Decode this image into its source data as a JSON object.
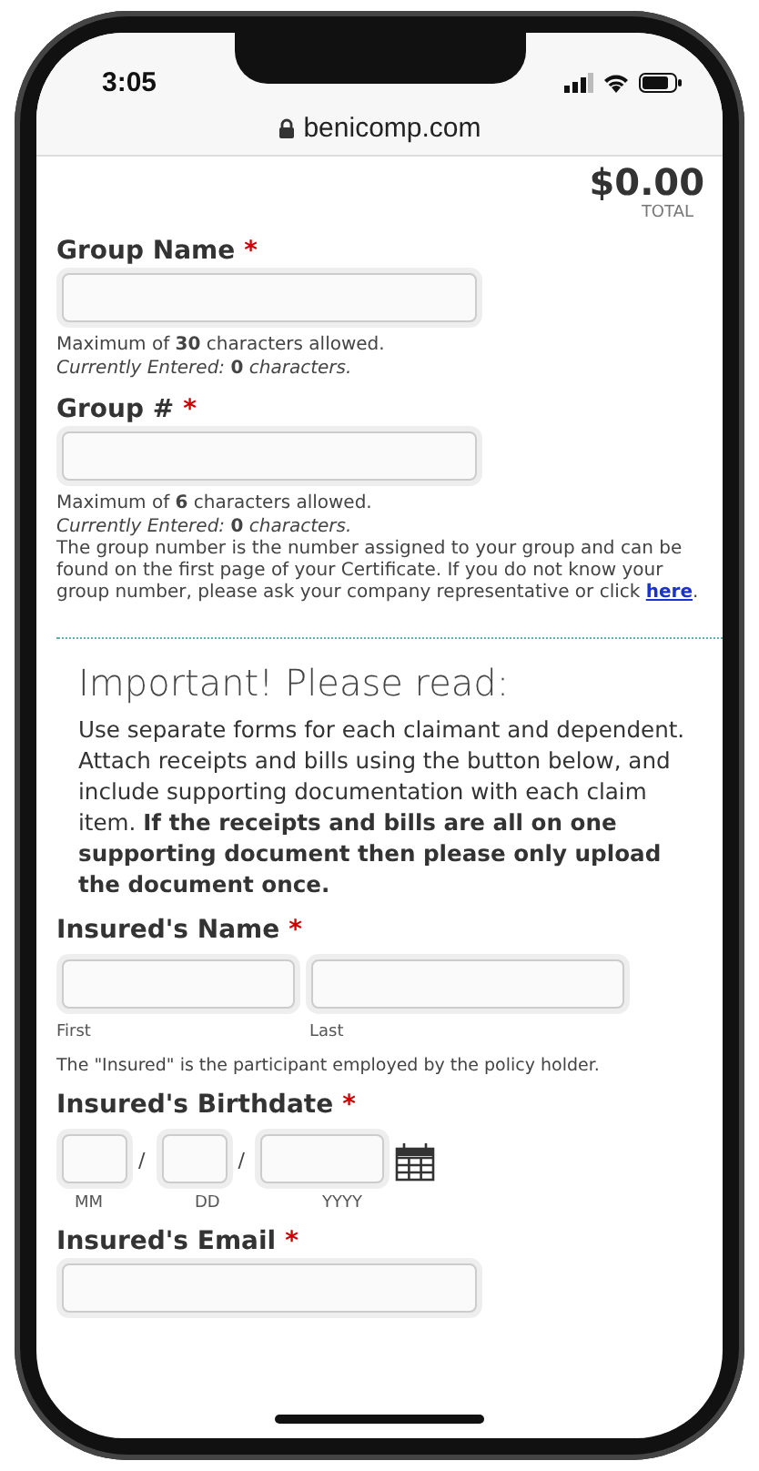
{
  "status_bar": {
    "time": "3:05"
  },
  "address_bar": {
    "url": "benicomp.com"
  },
  "total": {
    "amount": "$0.00",
    "label": "TOTAL"
  },
  "group_name": {
    "label": "Group Name",
    "required": "*",
    "hints": [
      "Maximum of **30** characters allowed.",
      "*Currently Entered:* **0** *characters.*"
    ]
  },
  "group_number": {
    "label": "Group #",
    "required": "*",
    "hints": [
      "Maximum of **6** characters allowed.",
      "*Currently Entered:* **0** *characters.*"
    ],
    "help": {
      "text": "The group number is the number assigned to your group and can be found on the first page of your Certificate. If you do not know your group number, please ask your company representative or click",
      "link": "here",
      "after": "."
    }
  },
  "notice": {
    "heading": "Important! Please read:",
    "body": "Use separate forms for each claimant and dependent. Attach receipts and bills using the button below, and include supporting documentation with each claim item. **If the receipts and bills are all on one supporting document then please only upload the document once.**"
  },
  "insured_name": {
    "label": "Insured's Name",
    "required": "*",
    "sublabels": [
      "First",
      "Last"
    ],
    "note": "The \"Insured\" is the participant employed by the policy holder."
  },
  "insured_birthdate": {
    "label": "Insured's Birthdate",
    "required": "*",
    "separators": [
      "/",
      "/"
    ],
    "sublabels": [
      "MM",
      "DD",
      "YYYY"
    ]
  },
  "insured_email": {
    "label": "Insured's Email",
    "required": "*"
  }
}
